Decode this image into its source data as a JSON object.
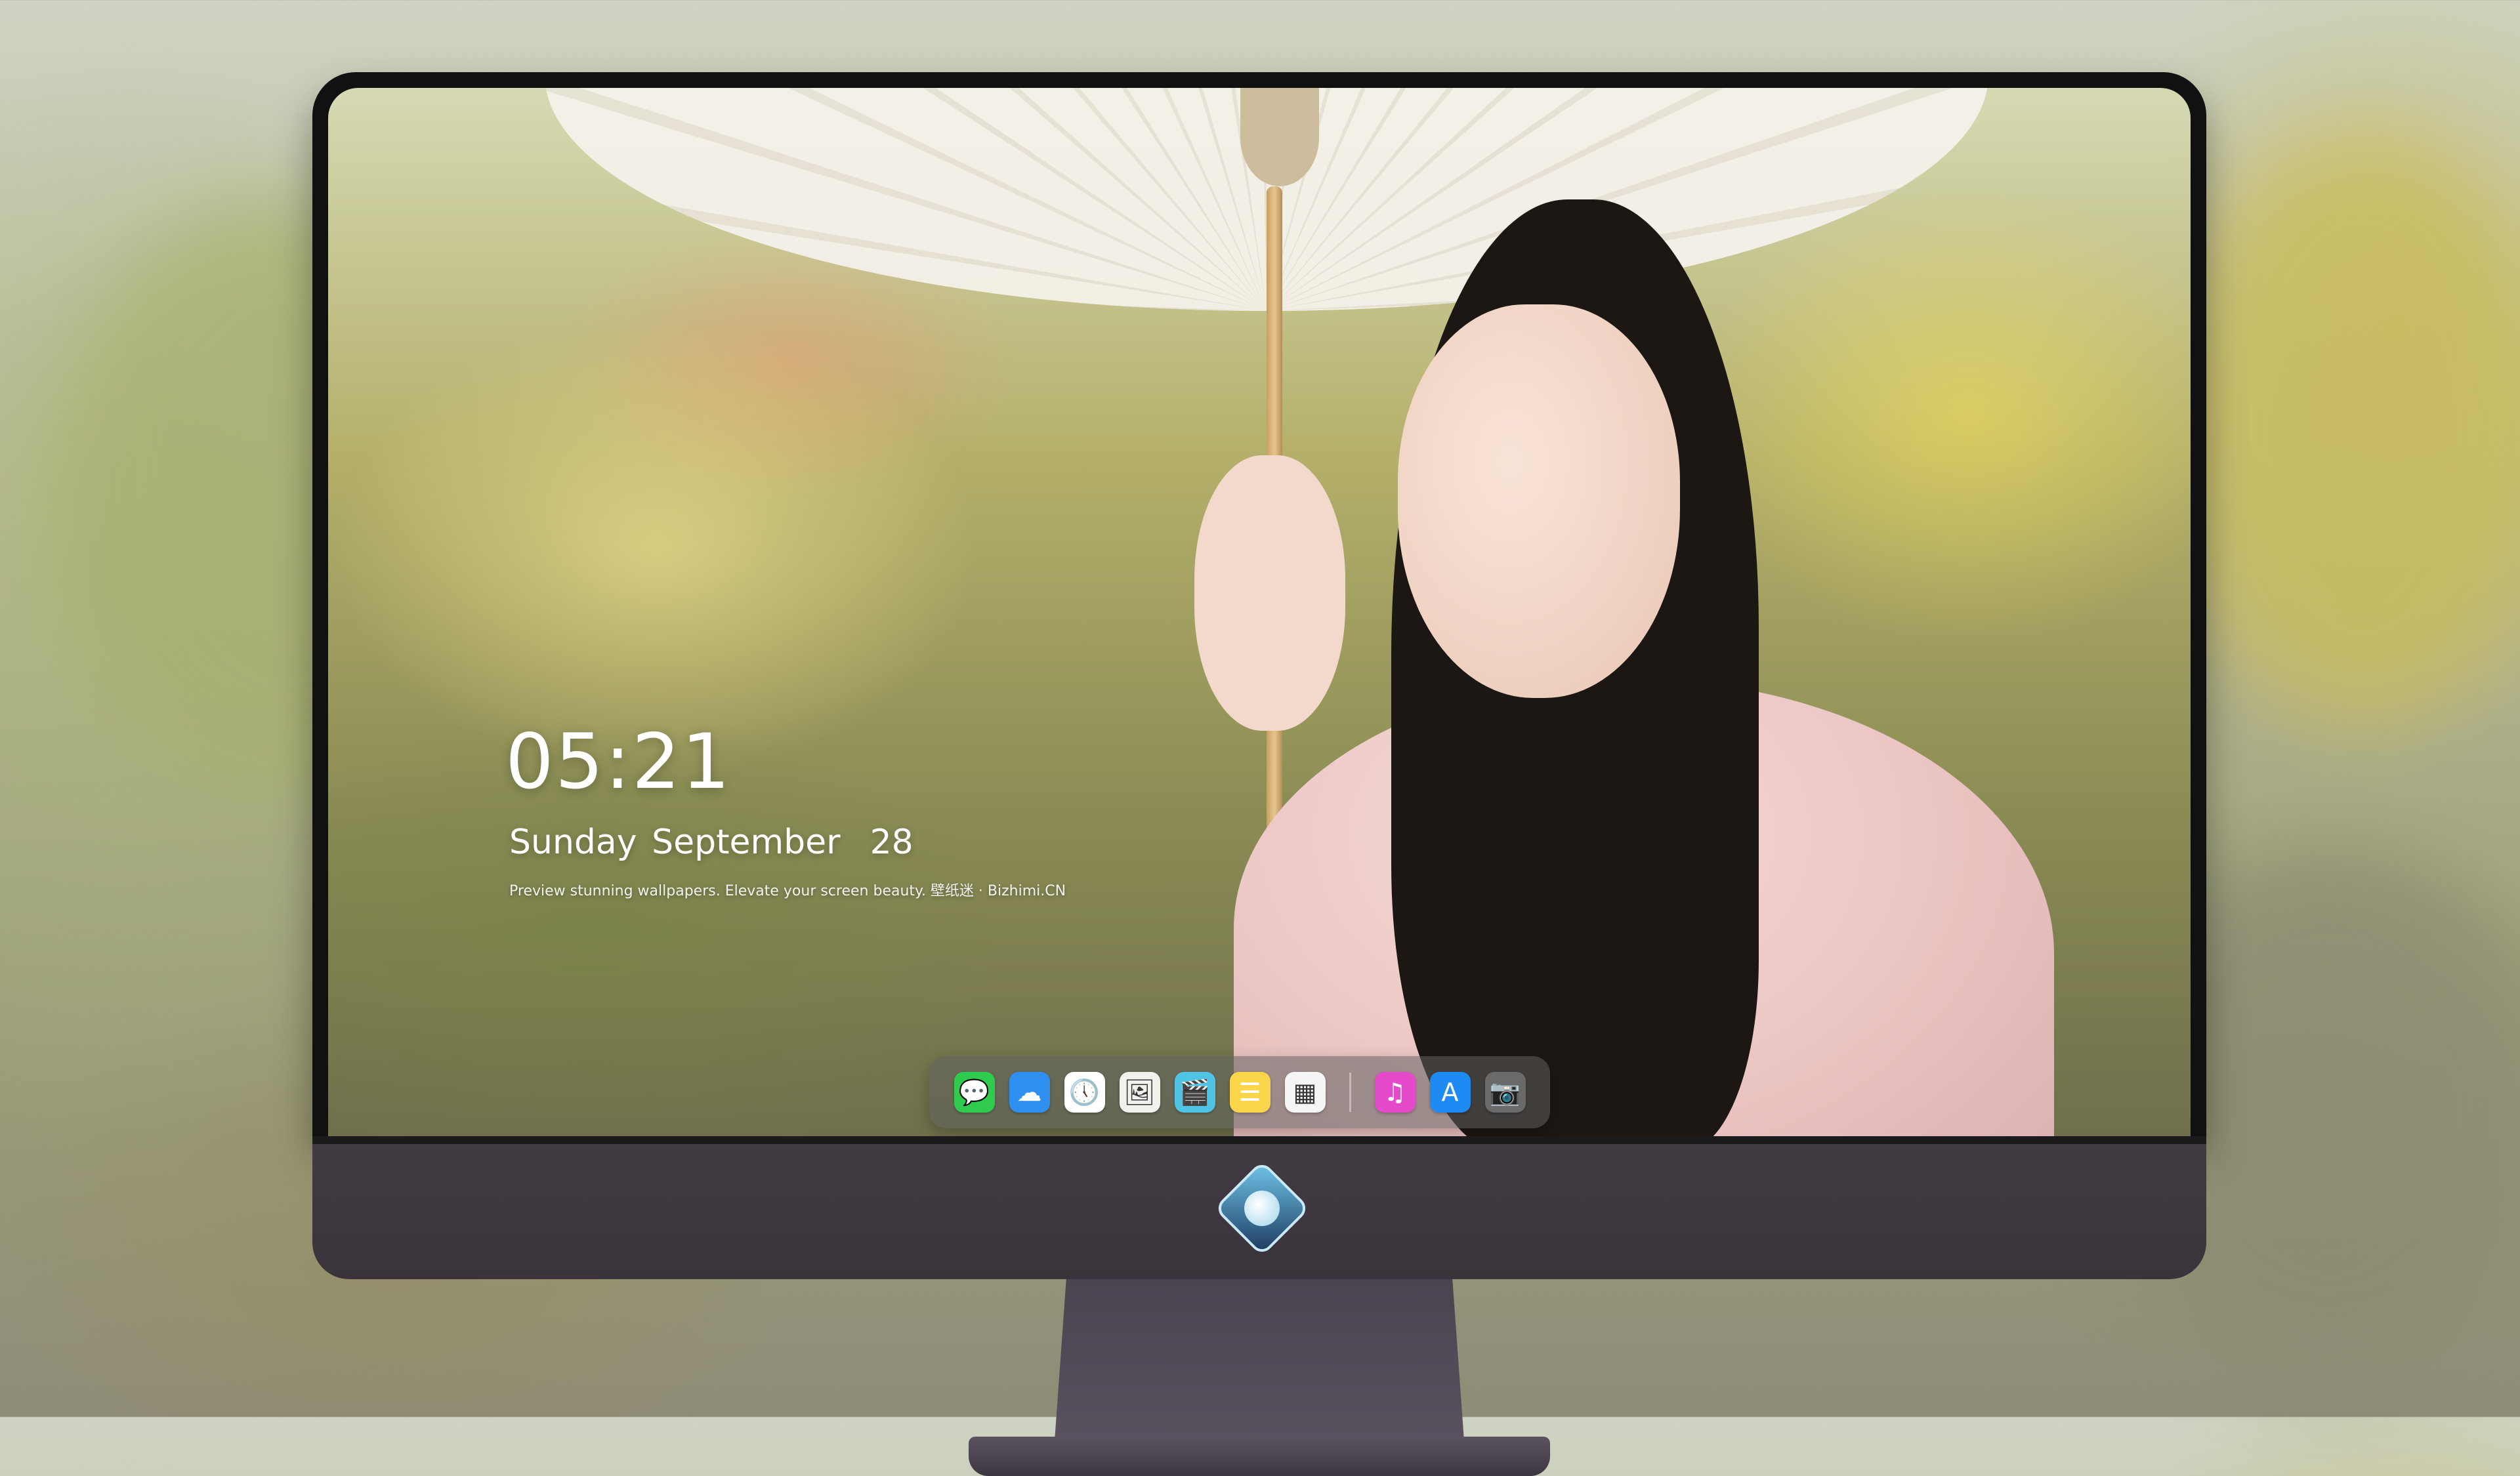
{
  "lockscreen": {
    "time": "05:21",
    "date": "Sunday September  28",
    "tagline": "Preview stunning wallpapers. Elevate your screen beauty. 壁纸迷 · Bizhimi.CN"
  },
  "dock": {
    "apps": [
      {
        "name": "messages-icon",
        "glyph": "💬",
        "color": "#2fcb4f"
      },
      {
        "name": "weather-icon",
        "glyph": "☁",
        "color": "#2e8ff0"
      },
      {
        "name": "clock-icon",
        "glyph": "🕔",
        "color": "#ffffff"
      },
      {
        "name": "preview-icon",
        "glyph": "🖼",
        "color": "#f1f1ee"
      },
      {
        "name": "clapper-icon",
        "glyph": "🎬",
        "color": "#4fc4e4"
      },
      {
        "name": "notes-icon",
        "glyph": "☰",
        "color": "#fbd64a"
      },
      {
        "name": "photo-booth-icon",
        "glyph": "▦",
        "color": "#f5f5f5"
      },
      {
        "name": "music-icon",
        "glyph": "♫",
        "color": "#e44ac9"
      },
      {
        "name": "app-store-icon",
        "glyph": "A",
        "color": "#1d8bf3"
      },
      {
        "name": "camera-icon",
        "glyph": "📷",
        "color": "#6a6a6a"
      }
    ],
    "separator_after_index": 6
  },
  "monitor": {
    "logo": "dragon-emblem-icon"
  }
}
